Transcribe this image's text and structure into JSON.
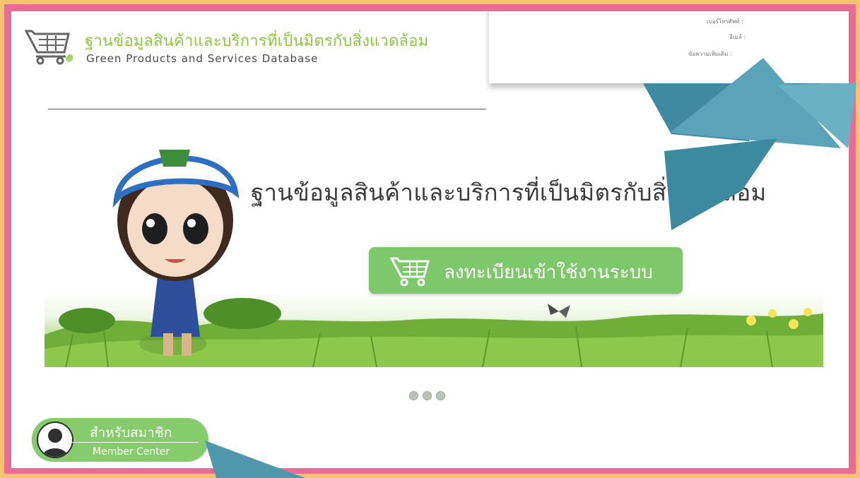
{
  "header": {
    "title_th": "ฐานข้อมูลสินค้าและบริการที่เป็นมิตรกับสิ่งแวดล้อม",
    "title_en": "Green Products and Services Database",
    "logo_icon": "shopping-cart-icon"
  },
  "overlay_form": {
    "labels": [
      "เบอร์โทรศัพท์ :",
      "อีเมล์ :",
      "ข้อความเพิ่มเติม :"
    ]
  },
  "banner": {
    "heading": "ฐานข้อมูลสินค้าและบริการที่เป็นมิตรกับสิ่งแวดล้อม",
    "register_button": "ลงทะเบียนเข้าใช้งานระบบ"
  },
  "carousel": {
    "dot_count": 3
  },
  "member": {
    "label_th": "สำหรับสมาชิก",
    "label_en": "Member Center"
  },
  "colors": {
    "brand_green": "#8fc63f",
    "button_green": "#7dc86a",
    "frame_pink": "#ea6b96",
    "frame_orange": "#f6c46a",
    "origami_blue": "#4f97ab"
  }
}
